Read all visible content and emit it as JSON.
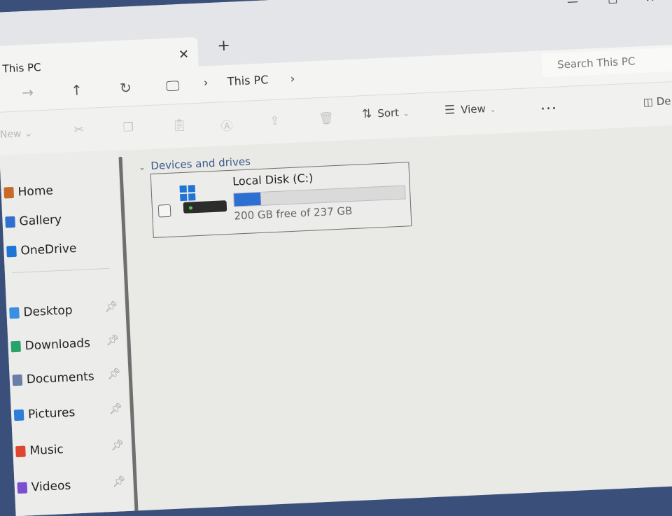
{
  "window": {
    "tab_title": "This PC",
    "tab_close": "✕",
    "new_tab": "+",
    "minimize": "—",
    "maximize": "☐",
    "close": "✕"
  },
  "address_bar": {
    "breadcrumb": [
      "This PC"
    ],
    "search_placeholder": "Search This PC"
  },
  "command_bar": {
    "new_label": "New",
    "sort_label": "Sort",
    "view_label": "View",
    "more_label": "...",
    "details_label": "De"
  },
  "sidebar": {
    "items": [
      {
        "label": "Home",
        "icon": "home-icon",
        "color": "#c96a2a"
      },
      {
        "label": "Gallery",
        "icon": "gallery-icon",
        "color": "#2f6fd0"
      },
      {
        "label": "OneDrive",
        "icon": "onedrive-icon",
        "color": "#1f74d6"
      },
      {
        "label": "Desktop",
        "icon": "desktop-icon",
        "color": "#3b8fe0",
        "pinned": true
      },
      {
        "label": "Downloads",
        "icon": "downloads-icon",
        "color": "#2aa36b",
        "pinned": true
      },
      {
        "label": "Documents",
        "icon": "documents-icon",
        "color": "#6a7ea8",
        "pinned": true
      },
      {
        "label": "Pictures",
        "icon": "pictures-icon",
        "color": "#2e7ed8",
        "pinned": true
      },
      {
        "label": "Music",
        "icon": "music-icon",
        "color": "#e0452f",
        "pinned": true
      },
      {
        "label": "Videos",
        "icon": "videos-icon",
        "color": "#7b4fd0",
        "pinned": true
      }
    ]
  },
  "content": {
    "group_title": "Devices and drives",
    "drives": [
      {
        "name": "Local Disk (C:)",
        "free_text": "200 GB free of 237 GB",
        "used_fraction": 0.156
      }
    ]
  },
  "colors": {
    "accent": "#2e6fd3",
    "windows_logo": "#1f74d6"
  }
}
